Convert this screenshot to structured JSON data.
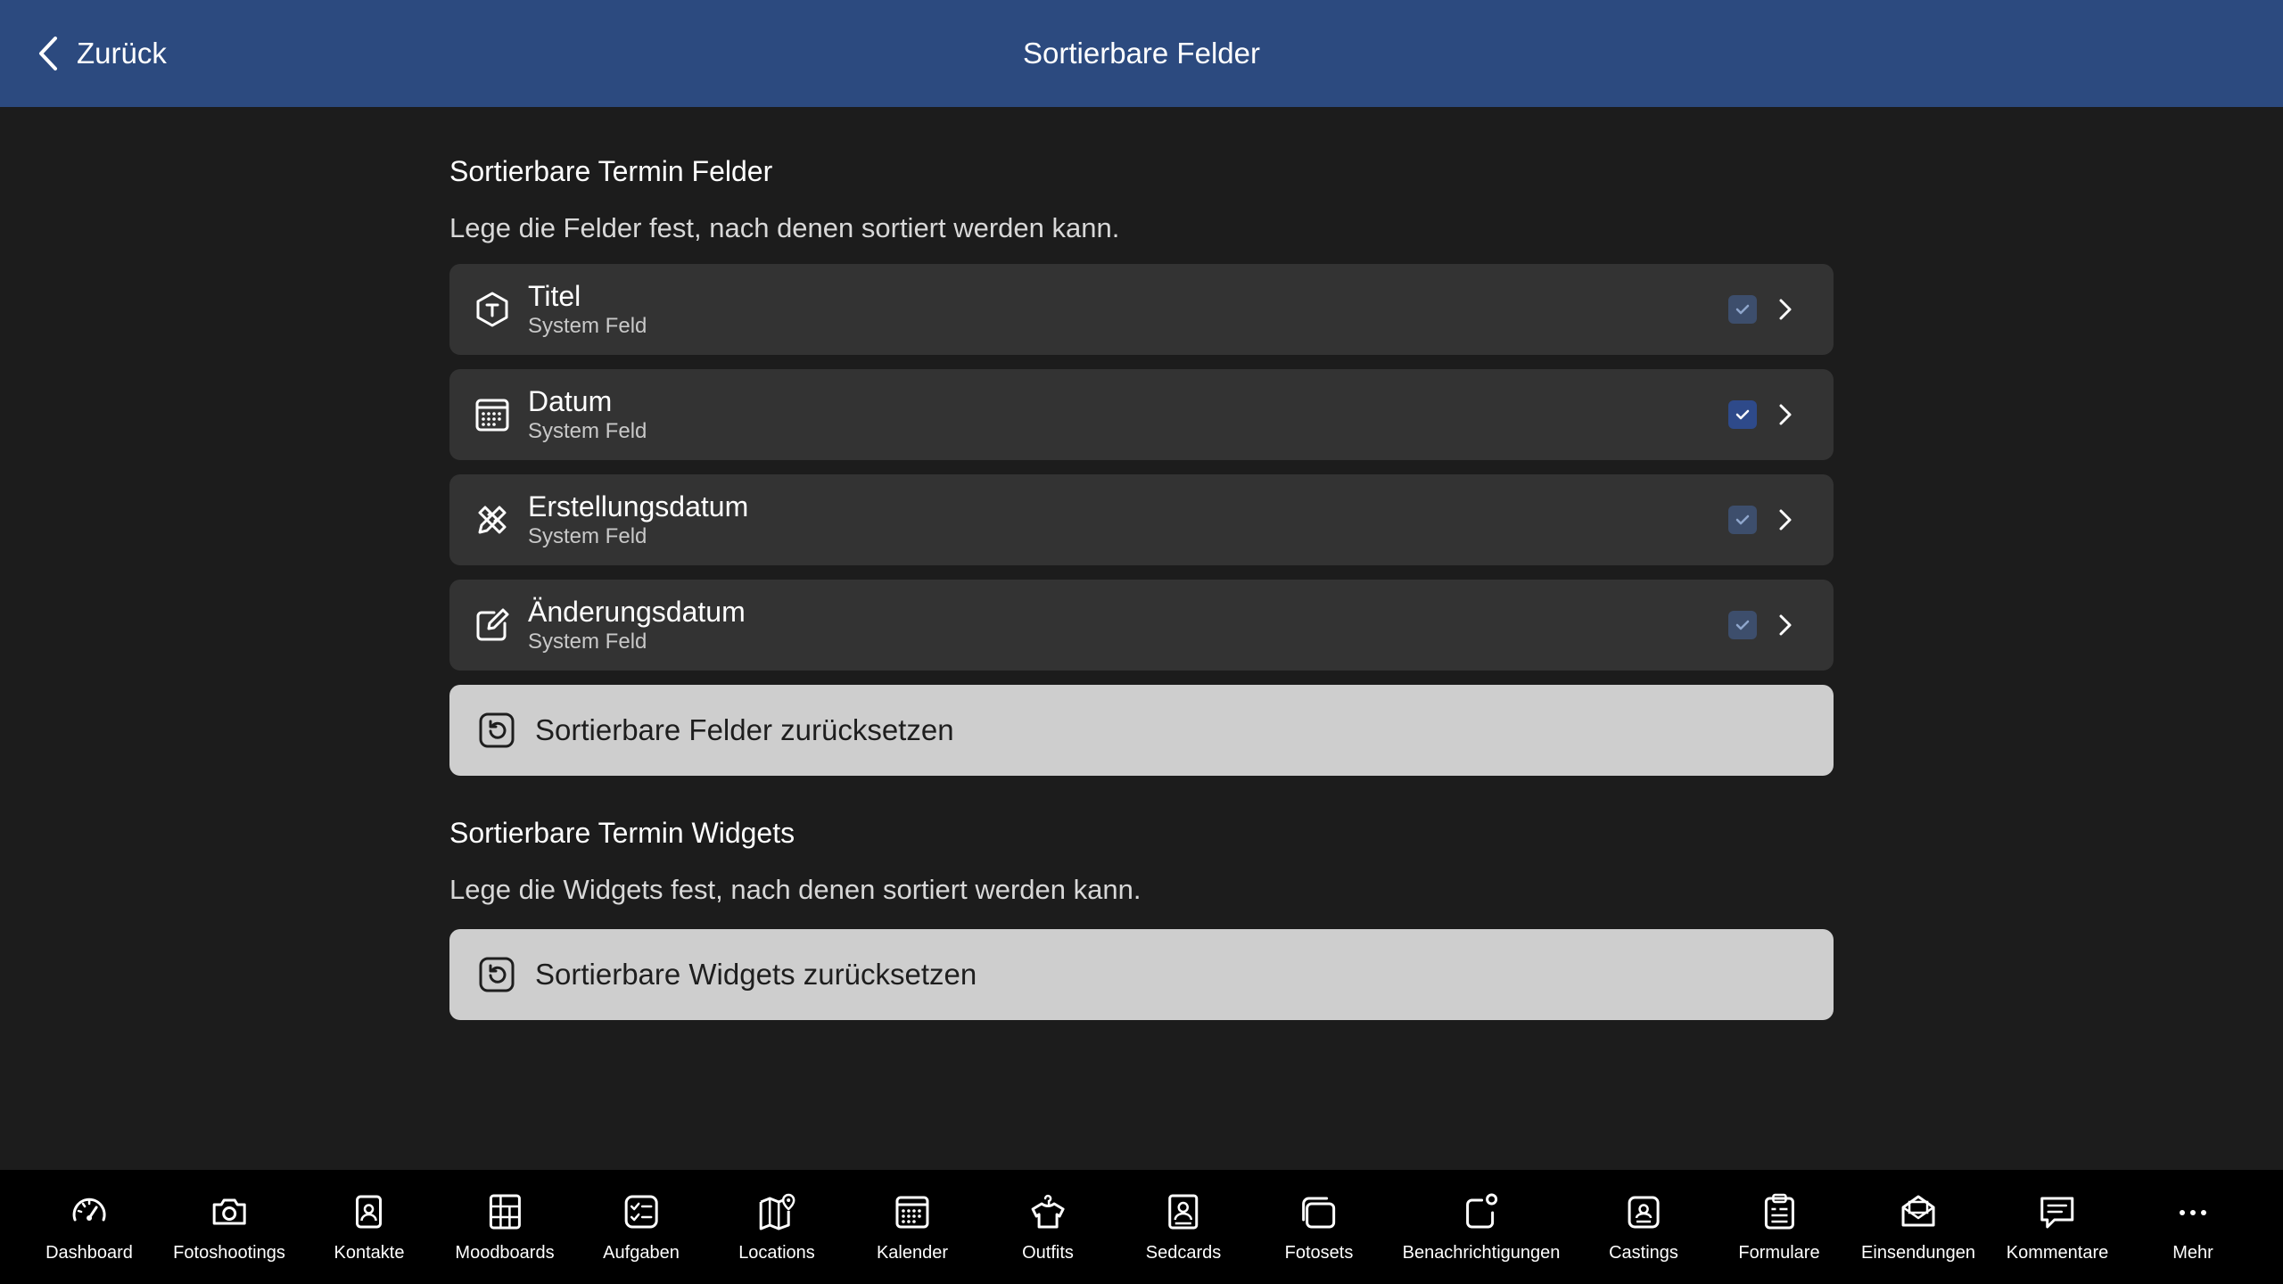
{
  "header": {
    "back_label": "Zurück",
    "title": "Sortierbare Felder",
    "background": "#2c4a7f"
  },
  "fields_section": {
    "title": "Sortierbare Termin Felder",
    "description": "Lege die Felder fest, nach denen sortiert werden kann.",
    "items": [
      {
        "name": "Titel",
        "subtitle": "System Feld",
        "icon": "title-icon",
        "checked": true
      },
      {
        "name": "Datum",
        "subtitle": "System Feld",
        "icon": "calendar-icon",
        "checked": true
      },
      {
        "name": "Erstellungsdatum",
        "subtitle": "System Feld",
        "icon": "pencil-ruler-icon",
        "checked": true
      },
      {
        "name": "Änderungsdatum",
        "subtitle": "System Feld",
        "icon": "edit-icon",
        "checked": true
      }
    ],
    "reset_label": "Sortierbare Felder zurücksetzen"
  },
  "widgets_section": {
    "title": "Sortierbare Termin Widgets",
    "description": "Lege die Widgets fest, nach denen sortiert werden kann.",
    "reset_label": "Sortierbare Widgets zurücksetzen"
  },
  "tabbar": {
    "items": [
      {
        "label": "Dashboard",
        "icon": "speedometer-icon"
      },
      {
        "label": "Fotoshootings",
        "icon": "camera-icon"
      },
      {
        "label": "Kontakte",
        "icon": "contact-icon"
      },
      {
        "label": "Moodboards",
        "icon": "grid-icon"
      },
      {
        "label": "Aufgaben",
        "icon": "checklist-icon"
      },
      {
        "label": "Locations",
        "icon": "map-icon"
      },
      {
        "label": "Kalender",
        "icon": "calendar-icon"
      },
      {
        "label": "Outfits",
        "icon": "hanger-icon"
      },
      {
        "label": "Sedcards",
        "icon": "id-card-icon"
      },
      {
        "label": "Fotosets",
        "icon": "photos-icon"
      },
      {
        "label": "Benachrichtigungen",
        "icon": "notification-icon"
      },
      {
        "label": "Castings",
        "icon": "badge-icon"
      },
      {
        "label": "Formulare",
        "icon": "clipboard-icon"
      },
      {
        "label": "Einsendungen",
        "icon": "mail-open-icon"
      },
      {
        "label": "Kommentare",
        "icon": "comment-icon"
      },
      {
        "label": "Mehr",
        "icon": "more-icon"
      }
    ]
  },
  "colors": {
    "background": "#1c1c1c",
    "row": "#333333",
    "reset_button": "#cecece",
    "accent": "#2e4a8a"
  }
}
